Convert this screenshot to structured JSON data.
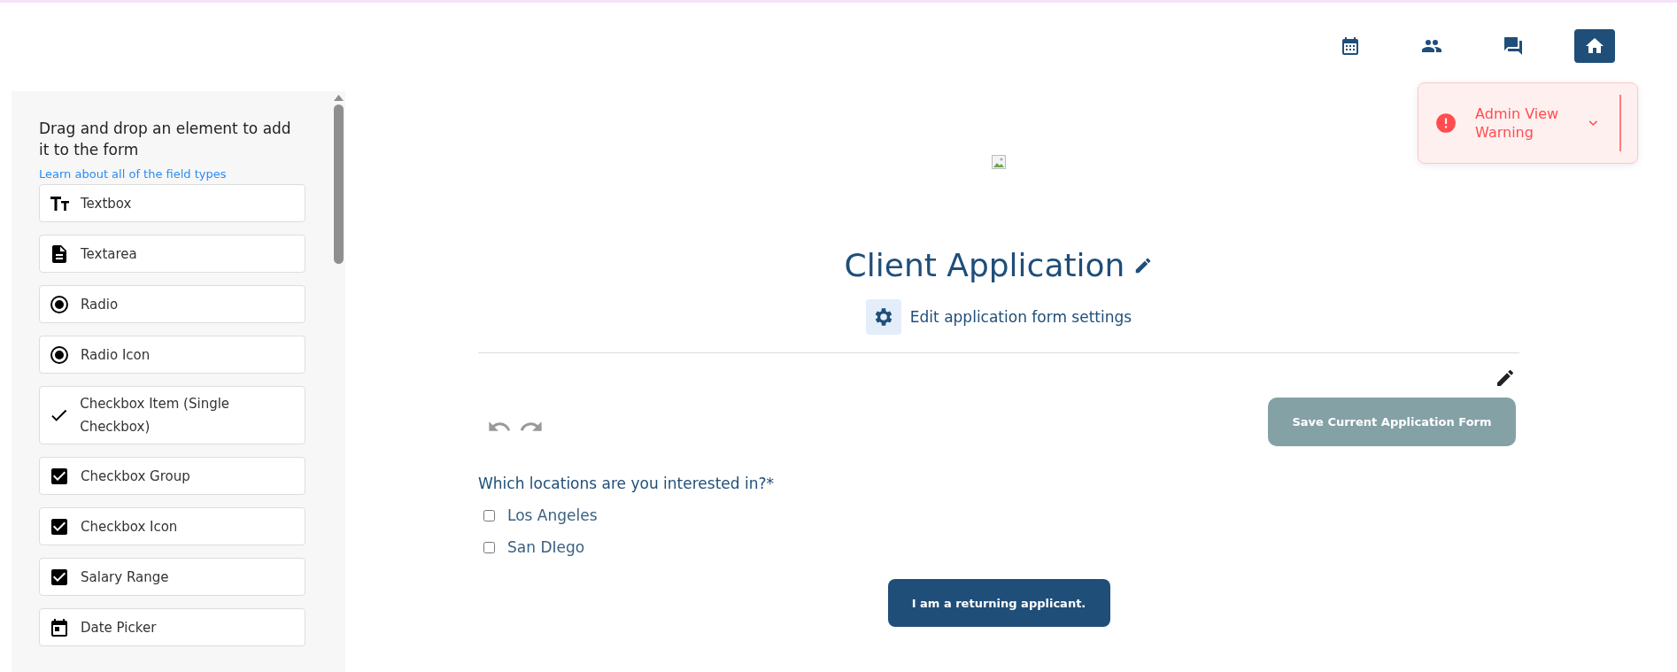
{
  "nav": {
    "items": [
      {
        "kind": "calendar",
        "selected": false
      },
      {
        "kind": "people",
        "selected": false
      },
      {
        "kind": "chat",
        "selected": false
      },
      {
        "kind": "home",
        "selected": true
      }
    ]
  },
  "toast": {
    "message": "Admin View Warning"
  },
  "sidebar": {
    "heading": "Drag and drop an element to add it to the form",
    "link": "Learn about all of the field types",
    "items": [
      {
        "kind": "textbox",
        "label": "Textbox"
      },
      {
        "kind": "textarea",
        "label": "Textarea"
      },
      {
        "kind": "radio",
        "label": "Radio"
      },
      {
        "kind": "radio",
        "label": "Radio Icon"
      },
      {
        "kind": "check",
        "label": "Checkbox Item (Single Checkbox)"
      },
      {
        "kind": "checkbox",
        "label": "Checkbox Group"
      },
      {
        "kind": "checkbox",
        "label": "Checkbox Icon"
      },
      {
        "kind": "checkbox",
        "label": "Salary Range"
      },
      {
        "kind": "date",
        "label": "Date Picker"
      }
    ]
  },
  "form": {
    "title": "Client Application",
    "settings_link": "Edit application form settings",
    "save_button": "Save Current Application Form",
    "question": "Which locations are you interested in?*",
    "options": [
      {
        "label": "Los Angeles",
        "checked": false
      },
      {
        "label": "San DIego",
        "checked": false
      }
    ],
    "returning_button": "I am a returning applicant."
  }
}
